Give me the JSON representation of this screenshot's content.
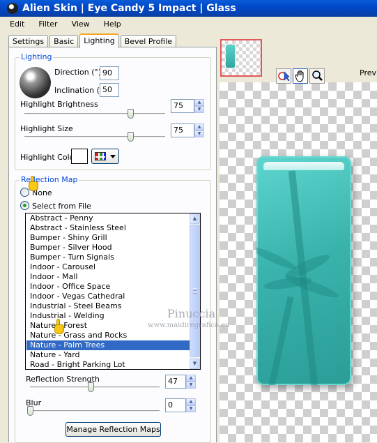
{
  "window": {
    "title": "Alien Skin  |  Eye Candy 5 Impact  |  Glass"
  },
  "menu": [
    "Edit",
    "Filter",
    "View",
    "Help"
  ],
  "tabs": [
    "Settings",
    "Basic",
    "Lighting",
    "Bevel Profile"
  ],
  "active_tab": "Lighting",
  "lighting": {
    "group_title": "Lighting",
    "direction_label": "Direction (°)",
    "direction_value": "90",
    "inclination_label": "Inclination (°)",
    "inclination_value": "50",
    "highlight_brightness_label": "Highlight Brightness",
    "highlight_brightness_value": "75",
    "highlight_brightness_level": 75,
    "highlight_size_label": "Highlight Size",
    "highlight_size_value": "75",
    "highlight_size_level": 75,
    "highlight_color_label": "Highlight Color",
    "highlight_color": "#ffffff"
  },
  "reflection": {
    "group_title": "Reflection Map",
    "none_label": "None",
    "select_label": "Select from File",
    "selected_option": "Select from File",
    "items": [
      "Abstract - Penny",
      "Abstract - Stainless Steel",
      "Bumper - Shiny Grill",
      "Bumper - Silver Hood",
      "Bumper - Turn Signals",
      "Indoor - Carousel",
      "Indoor - Mall",
      "Indoor - Office Space",
      "Indoor - Vegas Cathedral",
      "Industrial - Steel Beams",
      "Industrial - Welding",
      "Nature - Forest",
      "Nature - Grass and Rocks",
      "Nature - Palm Trees",
      "Nature - Yard",
      "Road - Bright Parking Lot"
    ],
    "selected_item": "Nature - Palm Trees",
    "strength_label": "Reflection Strength",
    "strength_value": "47",
    "strength_level": 47,
    "blur_label": "Blur",
    "blur_value": "0",
    "blur_level": 0,
    "manage_button": "Manage Reflection Maps"
  },
  "preview": {
    "label": "Previ",
    "watermark_name": "Pinuccia",
    "watermark_url": "www.maidiregrafica.eu",
    "glass_color": "#3bb3ad"
  },
  "icons": [
    "app-icon",
    "pointer-tool-icon",
    "hand-tool-icon",
    "zoom-tool-icon",
    "color-grid-icon",
    "pointing-hand-icon"
  ]
}
